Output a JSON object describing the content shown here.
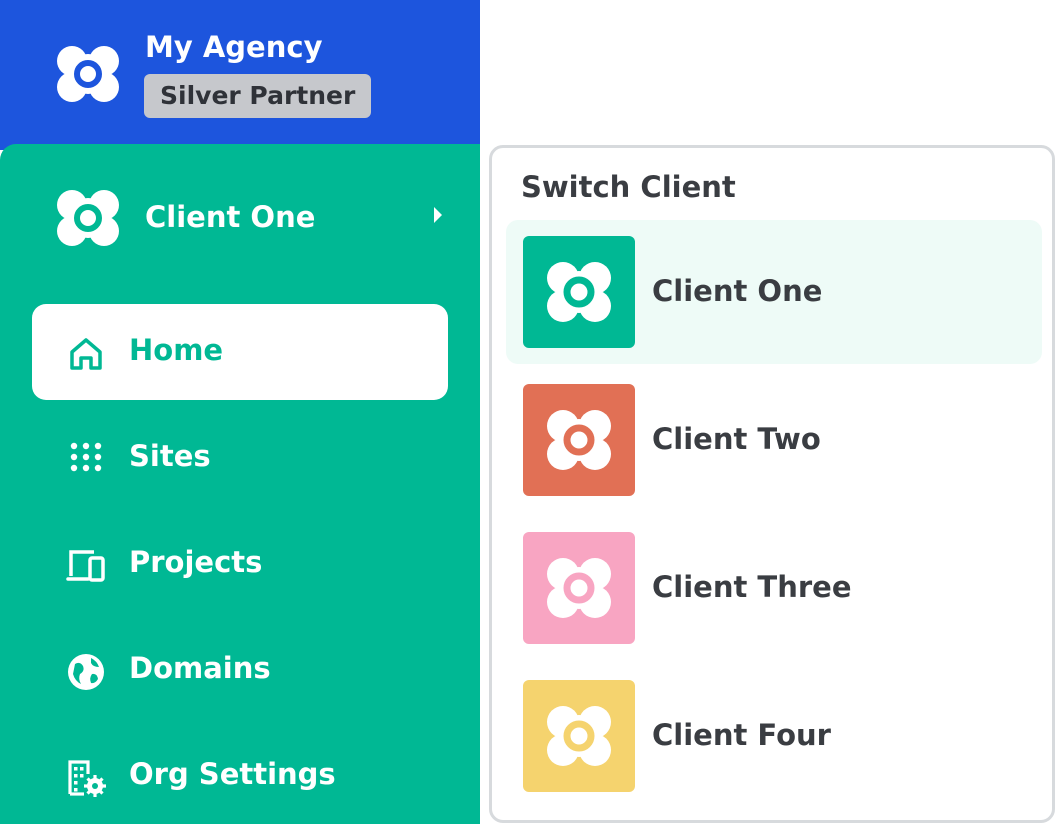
{
  "agency": {
    "name": "My Agency",
    "badge": "Silver Partner",
    "logo_icon": "flower-logo-icon",
    "color": "#1d55dd"
  },
  "sidebar": {
    "color": "#00b894",
    "current_client": {
      "name": "Client One",
      "logo_icon": "flower-logo-icon",
      "expand_icon": "chevron-right-icon"
    },
    "nav": [
      {
        "label": "Home",
        "icon": "home-icon",
        "active": true
      },
      {
        "label": "Sites",
        "icon": "grid-dots-icon",
        "active": false
      },
      {
        "label": "Projects",
        "icon": "devices-icon",
        "active": false
      },
      {
        "label": "Domains",
        "icon": "globe-icon",
        "active": false
      },
      {
        "label": "Org Settings",
        "icon": "building-gear-icon",
        "active": false
      }
    ]
  },
  "switcher": {
    "title": "Switch Client",
    "clients": [
      {
        "name": "Client One",
        "color": "#00b894",
        "selected": true
      },
      {
        "name": "Client Two",
        "color": "#e17055",
        "selected": false
      },
      {
        "name": "Client Three",
        "color": "#f8a5c2",
        "selected": false
      },
      {
        "name": "Client Four",
        "color": "#f5d36e",
        "selected": false
      }
    ]
  }
}
